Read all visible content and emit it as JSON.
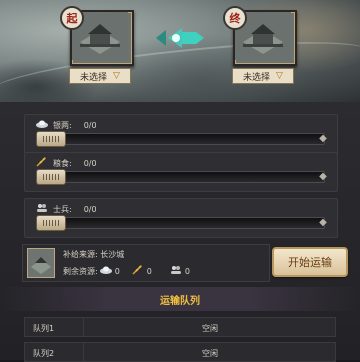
{
  "route": {
    "start_seal": "起",
    "end_seal": "终",
    "start_select": "未选择",
    "end_select": "未选择",
    "select_arrow": "▽"
  },
  "resources": [
    {
      "icon": "silver-ingot-icon",
      "label": "银两:",
      "value": "0/0"
    },
    {
      "icon": "grain-icon",
      "label": "粮食:",
      "value": "0/0"
    },
    {
      "icon": "soldier-icon",
      "label": "士兵:",
      "value": "0/0"
    }
  ],
  "source": {
    "label": "补给来源:",
    "city": "长沙城",
    "remaining_label": "剩余资源:",
    "silver": "0",
    "grain": "0",
    "soldiers": "0"
  },
  "start_button": "开始运输",
  "queue": {
    "title": "运输队列",
    "rows": [
      {
        "name": "队列1",
        "status": "空闲"
      },
      {
        "name": "队列2",
        "status": "空闲"
      }
    ]
  },
  "colors": {
    "accent_gold": "#f0c040",
    "seal_red": "#a02318",
    "arrow_teal": "#3fd0c0"
  }
}
